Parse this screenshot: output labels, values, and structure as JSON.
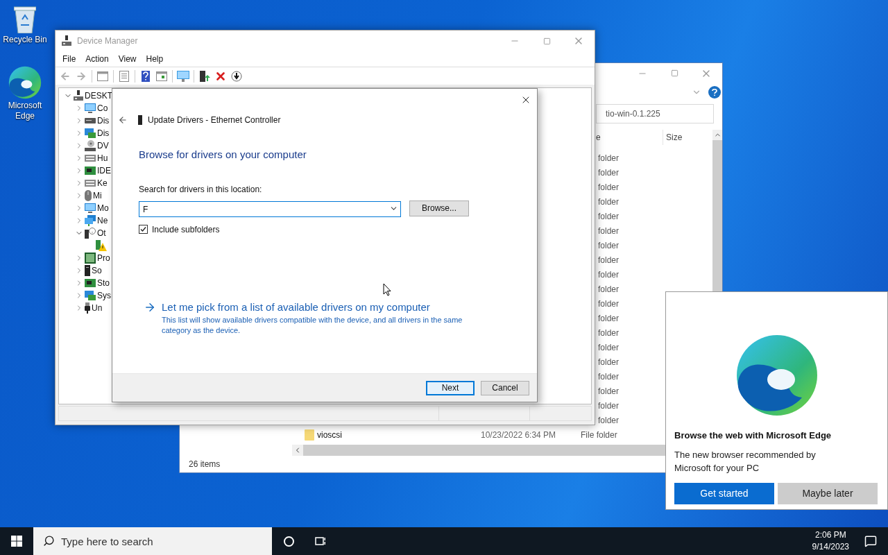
{
  "desktop_icons": [
    {
      "kind": "recycle",
      "label": "Recycle Bin"
    },
    {
      "kind": "edge",
      "label": "Microsoft Edge"
    }
  ],
  "file_explorer": {
    "address": "tio-win-0.1.225",
    "columns": [
      "e",
      "Size"
    ],
    "rows": [
      {
        "type": "folder"
      },
      {
        "type": "folder"
      },
      {
        "type": "folder"
      },
      {
        "type": "folder"
      },
      {
        "type": "folder"
      },
      {
        "type": "folder"
      },
      {
        "type": "folder"
      },
      {
        "type": "folder"
      },
      {
        "type": "folder"
      },
      {
        "type": "folder"
      },
      {
        "type": "folder"
      },
      {
        "type": "folder"
      },
      {
        "type": "folder"
      },
      {
        "type": "folder"
      },
      {
        "type": "folder"
      },
      {
        "type": "folder"
      },
      {
        "type": "folder"
      },
      {
        "type": "folder"
      },
      {
        "type": "folder"
      }
    ],
    "last_row": {
      "name": "vioscsi",
      "date": "10/23/2022 6:34 PM",
      "type": "File folder"
    },
    "status": "26 items"
  },
  "device_manager": {
    "title": "Device Manager",
    "menu": [
      "File",
      "Action",
      "View",
      "Help"
    ],
    "tree": {
      "label": "DESKT",
      "kind": "computer-root",
      "expanded": true,
      "children": [
        {
          "label": "Co",
          "kind": "monitor",
          "expanded": false
        },
        {
          "label": "Dis",
          "kind": "drive",
          "expanded": false
        },
        {
          "label": "Dis",
          "kind": "display",
          "expanded": false
        },
        {
          "label": "DV",
          "kind": "dvd",
          "expanded": false
        },
        {
          "label": "Hu",
          "kind": "keyboard",
          "expanded": false
        },
        {
          "label": "IDE",
          "kind": "card",
          "expanded": false
        },
        {
          "label": "Ke",
          "kind": "keyboard",
          "expanded": false
        },
        {
          "label": "Mi",
          "kind": "mouse",
          "expanded": false
        },
        {
          "label": "Mo",
          "kind": "monitor",
          "expanded": false
        },
        {
          "label": "Ne",
          "kind": "network",
          "expanded": false
        },
        {
          "label": "Ot",
          "kind": "unknown",
          "expanded": true,
          "children": [
            {
              "kind": "warning"
            }
          ]
        },
        {
          "label": "Pro",
          "kind": "chip",
          "expanded": false
        },
        {
          "label": "So",
          "kind": "tower",
          "expanded": false
        },
        {
          "label": "Sto",
          "kind": "card",
          "expanded": false
        },
        {
          "label": "Sys",
          "kind": "display",
          "expanded": false
        },
        {
          "label": "Un",
          "kind": "plug",
          "expanded": false
        }
      ]
    }
  },
  "dialog": {
    "title": "Update Drivers - Ethernet Controller",
    "heading": "Browse for drivers on your computer",
    "location_label": "Search for drivers in this location:",
    "location_value": "F",
    "browse_button": "Browse...",
    "include_subfolders": {
      "label": "Include subfolders",
      "checked": true
    },
    "pick_link": "Let me pick from a list of available drivers on my computer",
    "pick_description": "This list will show available drivers compatible with the device, and all drivers in the same category as the device.",
    "buttons": [
      {
        "label": "Next",
        "default": true
      },
      {
        "label": "Cancel",
        "default": false
      }
    ]
  },
  "edge_popup": {
    "title": "Browse the web with Microsoft Edge",
    "body": "The new browser recommended by Microsoft for your PC",
    "buttons": [
      {
        "label": "Get started",
        "kind": "primary"
      },
      {
        "label": "Maybe later",
        "kind": "secondary"
      }
    ]
  },
  "taskbar": {
    "search_placeholder": "Type here to search",
    "time": "2:06 PM",
    "date": "9/14/2023"
  }
}
